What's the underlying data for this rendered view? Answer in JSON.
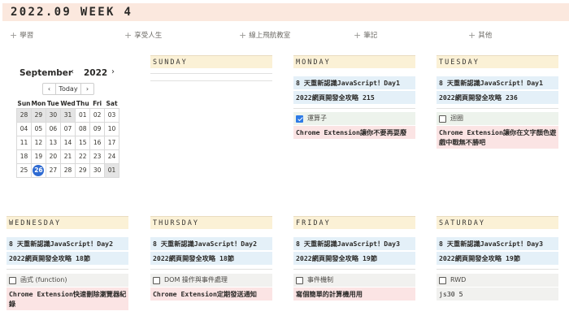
{
  "header": {
    "title": "2022.09 WEEK 4"
  },
  "categories": [
    {
      "label": "學習"
    },
    {
      "label": "享受人生"
    },
    {
      "label": "線上飛航教室"
    },
    {
      "label": "筆記"
    },
    {
      "label": "其他"
    }
  ],
  "calendar": {
    "month": "September",
    "year": "2022",
    "prev_glyph": "‹",
    "next_glyph": "›",
    "today_label": "Today",
    "weekdays": [
      "Sun",
      "Mon",
      "Tue",
      "Wed",
      "Thu",
      "Fri",
      "Sat"
    ],
    "weeks": [
      [
        "28",
        "29",
        "30",
        "31",
        "01",
        "02",
        "03"
      ],
      [
        "04",
        "05",
        "06",
        "07",
        "08",
        "09",
        "10"
      ],
      [
        "11",
        "12",
        "13",
        "14",
        "15",
        "16",
        "17"
      ],
      [
        "18",
        "19",
        "20",
        "21",
        "22",
        "23",
        "24"
      ],
      [
        "25",
        "26",
        "27",
        "28",
        "29",
        "30",
        "01"
      ]
    ],
    "today": "26"
  },
  "days": {
    "sunday": {
      "name": "SUNDAY"
    },
    "monday": {
      "name": "MONDAY",
      "course": "8 天重新認識JavaScript！Day1",
      "course2": "2022網頁開發全攻略 215",
      "task": "運算子",
      "task_done": true,
      "note": "Chrome Extension讓你不要再耍廢"
    },
    "tuesday": {
      "name": "TUESDAY",
      "course": "8 天重新認識JavaScript！Day1",
      "course2": "2022網頁開發全攻略 236",
      "task": "迴圈",
      "task_done": false,
      "note": "Chrome Extension讓你在文字顏色遊戲中戰無不勝吧"
    },
    "wednesday": {
      "name": "WEDNESDAY",
      "course": "8 天重新認識JavaScript！Day2",
      "course2": "2022網頁開發全攻略 18節",
      "task": "函式 (function)",
      "task_done": false,
      "note": "Chrome Extension快速刪除瀏覽器紀錄"
    },
    "thursday": {
      "name": "THURSDAY",
      "course": "8 天重新認識JavaScript！Day2",
      "course2": "2022網頁開發全攻略 18節",
      "task": "DOM 操作與事件處理",
      "task_done": false,
      "note": "Chrome Extension定期發送通知"
    },
    "friday": {
      "name": "FRIDAY",
      "course": "8 天重新認識JavaScript！Day3",
      "course2": "2022網頁開發全攻略 19節",
      "task": "事件機制",
      "task_done": false,
      "note": "寫個簡單的計算機用用"
    },
    "saturday": {
      "name": "SATURDAY",
      "course": "8 天重新認識JavaScript！Day3",
      "course2": "2022網頁開發全攻略 19節",
      "task": "RWD",
      "task_done": false,
      "note": "js30 5"
    }
  }
}
